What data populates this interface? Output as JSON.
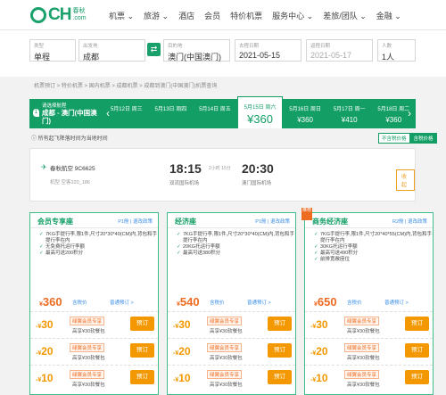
{
  "brand": {
    "name": "CH",
    "suffix": ".com",
    "sub": "春秋"
  },
  "menu": [
    "机票 ⌄",
    "旅游 ⌄",
    "酒店",
    "会员",
    "特价机票",
    "服务中心 ⌄",
    "差旅/团队 ⌄",
    "金融 ⌄"
  ],
  "search": {
    "type_label": "类型",
    "type_value": "单程",
    "from_label": "出发地",
    "from_value": "成都",
    "to_label": "目的地",
    "to_value": "澳门(中国澳门)",
    "depart_label": "去程日期",
    "depart_value": "2021-05-15",
    "return_label": "返程日期",
    "return_value": "2021-05-17",
    "pax_label": "人数",
    "pax_value": "1人"
  },
  "breadcrumb": "机票预订 > 特价机票 > 国内机票 > 成都机票 > 成都到澳门(中国澳门)机票查询",
  "route": {
    "hint": "请选择航程",
    "text": "成都 - 澳门(中国澳门)",
    "step": "1"
  },
  "dates": [
    {
      "day": "5月12日 周三",
      "price": ""
    },
    {
      "day": "5月13日 周四",
      "price": ""
    },
    {
      "day": "5月14日 周五",
      "price": ""
    },
    {
      "day": "5月15日 周六",
      "price": "¥360"
    },
    {
      "day": "5月16日 周日",
      "price": "¥360"
    },
    {
      "day": "5月17日 周一",
      "price": "¥410"
    },
    {
      "day": "5月18日 周二",
      "price": "¥360"
    }
  ],
  "tz_note": "所有起飞降落时间为当地时间",
  "tax_toggle": [
    "不含税价格",
    "含税价格"
  ],
  "flight": {
    "airline": "春秋航空 9C6625",
    "model": "机型 空客320_186",
    "dep_time": "18:15",
    "arr_time": "20:30",
    "duration": "2小时 15分",
    "dep_airport": "双流国际机场",
    "arr_airport": "澳门国际机场",
    "collapse": "收起"
  },
  "cabins": [
    {
      "name": "会员专享座",
      "code": "P1舱 | 退改政策",
      "hot": "",
      "perks": [
        "7KG手提行李,限1件,尺寸20*30*40(CM)内,背包和手提行李在内",
        "无免费托运行李额",
        "最高可送200积分"
      ],
      "price": "360",
      "points": "含税价",
      "vip": "普通预订 >",
      "book": "普通预订",
      "offers": [
        {
          "amt": "30",
          "badge": "绿翼会员专享",
          "note": "高享¥30软餐包",
          "btn": "预订"
        },
        {
          "amt": "20",
          "badge": "绿翼会员专享",
          "note": "高享¥30软餐包",
          "btn": "预订"
        },
        {
          "amt": "10",
          "badge": "绿翼会员专享",
          "note": "高享¥30软餐包",
          "btn": "预订"
        }
      ]
    },
    {
      "name": "经济座",
      "code": "P1舱 | 退改政策",
      "hot": "",
      "perks": [
        "7KG手提行李,限1件,尺寸20*30*40(CM)内,背包和手提行李在内",
        "20KG托运行李额",
        "最高可送380积分"
      ],
      "price": "540",
      "points": "含税价",
      "vip": "普通预订 >",
      "book": "普通预订",
      "offers": [
        {
          "amt": "30",
          "badge": "绿翼会员专享",
          "note": "高享¥30软餐包",
          "btn": "预订"
        },
        {
          "amt": "20",
          "badge": "绿翼会员专享",
          "note": "高享¥30软餐包",
          "btn": "预订"
        },
        {
          "amt": "10",
          "badge": "绿翼会员专享",
          "note": "高享¥30软餐包",
          "btn": "预订"
        }
      ]
    },
    {
      "name": "商务经济座",
      "code": "R2舱 | 退改政策",
      "hot": "推荐",
      "perks": [
        "7KG手提行李,限1件,尺寸20*40*55(CM)内,背包和手提行李在内",
        "30KG托运行李额",
        "最高可送490积分",
        "前排宽敞座位"
      ],
      "price": "650",
      "points": "含税价",
      "vip": "普通预订 >",
      "book": "普通预订",
      "offers": [
        {
          "amt": "30",
          "badge": "绿翼会员专享",
          "note": "高享¥30软餐包",
          "btn": "预订"
        },
        {
          "amt": "20",
          "badge": "绿翼会员专享",
          "note": "高享¥30软餐包",
          "btn": "预订"
        },
        {
          "amt": "10",
          "badge": "绿翼会员专享",
          "note": "高享¥30软餐包",
          "btn": "预订"
        }
      ]
    }
  ],
  "colors": {
    "brand_green": "#139e66",
    "accent_orange": "#f39800"
  }
}
